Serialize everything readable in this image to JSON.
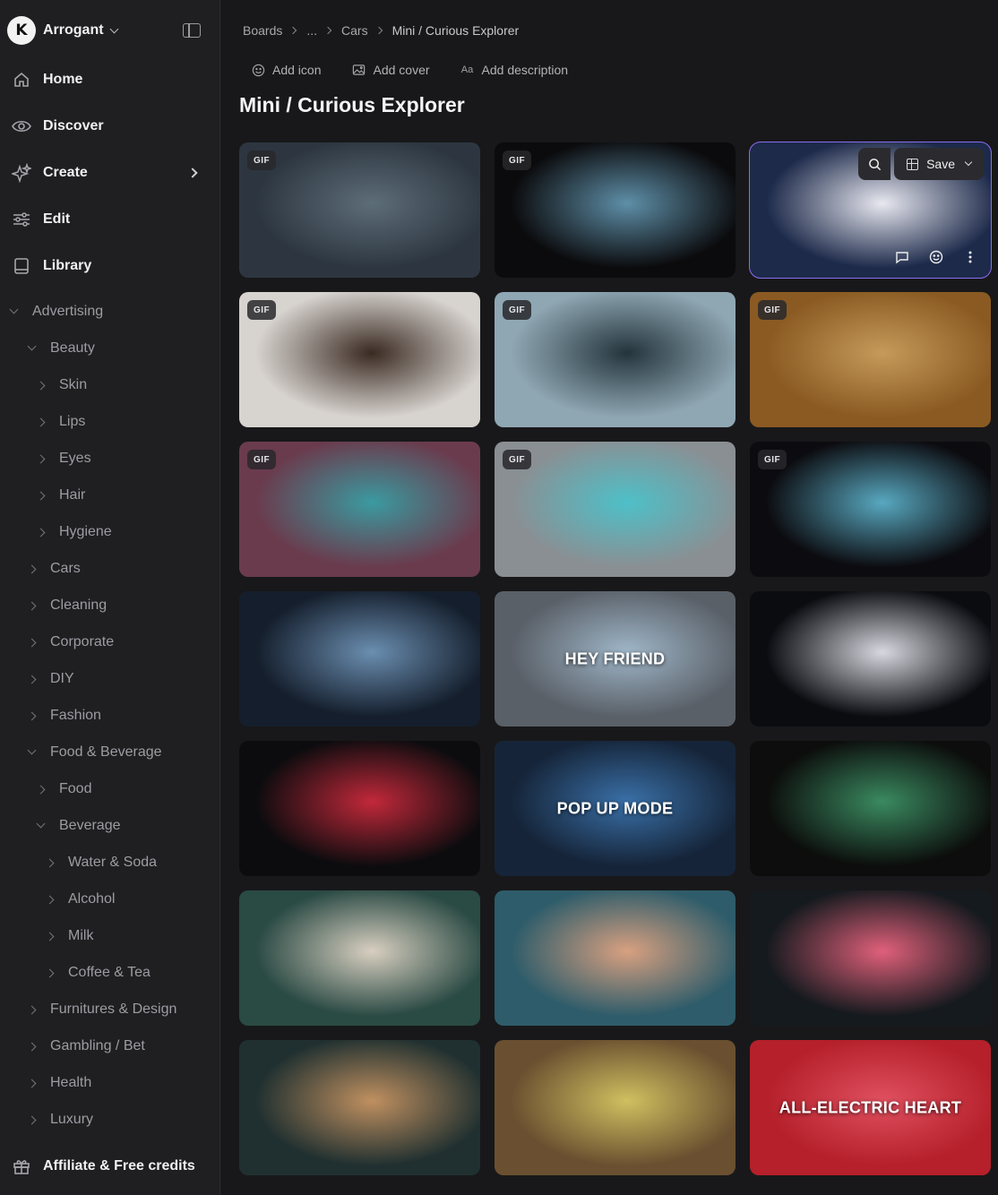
{
  "workspace": {
    "name": "Arrogant",
    "logo_letter": "K"
  },
  "nav": [
    {
      "label": "Home",
      "icon": "home-icon"
    },
    {
      "label": "Discover",
      "icon": "eye-icon"
    },
    {
      "label": "Create",
      "icon": "sparkle-icon"
    },
    {
      "label": "Edit",
      "icon": "sliders-icon"
    },
    {
      "label": "Library",
      "icon": "book-icon"
    }
  ],
  "tree": [
    {
      "label": "Advertising",
      "depth": 0,
      "expanded": true
    },
    {
      "label": "Beauty",
      "depth": 1,
      "expanded": true
    },
    {
      "label": "Skin",
      "depth": 2,
      "expanded": false
    },
    {
      "label": "Lips",
      "depth": 2,
      "expanded": false
    },
    {
      "label": "Eyes",
      "depth": 2,
      "expanded": false
    },
    {
      "label": "Hair",
      "depth": 2,
      "expanded": false
    },
    {
      "label": "Hygiene",
      "depth": 2,
      "expanded": false
    },
    {
      "label": "Cars",
      "depth": 1,
      "expanded": false
    },
    {
      "label": "Cleaning",
      "depth": 1,
      "expanded": false
    },
    {
      "label": "Corporate",
      "depth": 1,
      "expanded": false
    },
    {
      "label": "DIY",
      "depth": 1,
      "expanded": false
    },
    {
      "label": "Fashion",
      "depth": 1,
      "expanded": false
    },
    {
      "label": "Food & Beverage",
      "depth": 1,
      "expanded": true
    },
    {
      "label": "Food",
      "depth": 2,
      "expanded": false
    },
    {
      "label": "Beverage",
      "depth": 2,
      "expanded": true
    },
    {
      "label": "Water & Soda",
      "depth": 3,
      "expanded": false
    },
    {
      "label": "Alcohol",
      "depth": 3,
      "expanded": false
    },
    {
      "label": "Milk",
      "depth": 3,
      "expanded": false
    },
    {
      "label": "Coffee & Tea",
      "depth": 3,
      "expanded": false
    },
    {
      "label": "Furnitures & Design",
      "depth": 1,
      "expanded": false
    },
    {
      "label": "Gambling / Bet",
      "depth": 1,
      "expanded": false
    },
    {
      "label": "Health",
      "depth": 1,
      "expanded": false
    },
    {
      "label": "Luxury",
      "depth": 1,
      "expanded": false
    }
  ],
  "affiliate": {
    "label": "Affiliate & Free credits",
    "icon": "gift-icon"
  },
  "breadcrumb": [
    "Boards",
    "...",
    "Cars",
    "Mini / Curious Explorer"
  ],
  "actions": [
    {
      "label": "Add icon",
      "icon": "smiley-icon"
    },
    {
      "label": "Add cover",
      "icon": "image-icon"
    },
    {
      "label": "Add description",
      "icon": "text-icon"
    }
  ],
  "page": {
    "title": "Mini / Curious Explorer"
  },
  "tile_actions": {
    "save_label": "Save"
  },
  "tiles": [
    {
      "badge": "GIF",
      "text": "",
      "bg": "#2d3640",
      "accent": "#5d6d78"
    },
    {
      "badge": "GIF",
      "text": "",
      "bg": "#0b0b0d",
      "accent": "#5e8fa8"
    },
    {
      "badge": "",
      "text": "",
      "bg": "#1d2a4a",
      "accent": "#e8e8f0",
      "selected": true
    },
    {
      "badge": "GIF",
      "text": "",
      "bg": "#d7d3cf",
      "accent": "#3a2a22"
    },
    {
      "badge": "GIF",
      "text": "",
      "bg": "#8fa7b3",
      "accent": "#24343c"
    },
    {
      "badge": "GIF",
      "text": "",
      "bg": "#8a5a22",
      "accent": "#c59a5a"
    },
    {
      "badge": "GIF",
      "text": "",
      "bg": "#6a3b4d",
      "accent": "#3b9aa0"
    },
    {
      "badge": "GIF",
      "text": "",
      "bg": "#8a8f93",
      "accent": "#4ec0c8"
    },
    {
      "badge": "GIF",
      "text": "",
      "bg": "#0c0c10",
      "accent": "#58a8c0"
    },
    {
      "badge": "",
      "text": "",
      "bg": "#141e2c",
      "accent": "#6b8eb0"
    },
    {
      "badge": "",
      "text": "HEY FRIEND",
      "bg": "#5a6068",
      "accent": "#9fb6c8"
    },
    {
      "badge": "",
      "text": "",
      "bg": "#0a0c10",
      "accent": "#d8d8e0"
    },
    {
      "badge": "",
      "text": "",
      "bg": "#0c0c0e",
      "accent": "#c2283a"
    },
    {
      "badge": "",
      "text": "POP UP MODE",
      "bg": "#152438",
      "accent": "#3a70a8"
    },
    {
      "badge": "",
      "text": "",
      "bg": "#0c0d0c",
      "accent": "#3a8a60"
    },
    {
      "badge": "",
      "text": "",
      "bg": "#2a4a44",
      "accent": "#d8cfc0"
    },
    {
      "badge": "",
      "text": "",
      "bg": "#2e5c6a",
      "accent": "#d8a080"
    },
    {
      "badge": "",
      "text": "",
      "bg": "#151a1e",
      "accent": "#e0607a"
    },
    {
      "badge": "",
      "text": "",
      "bg": "#203030",
      "accent": "#c09060"
    },
    {
      "badge": "",
      "text": "",
      "bg": "#6a5030",
      "accent": "#d0c060"
    },
    {
      "badge": "",
      "text": "ALL-ELECTRIC HEART",
      "bg": "#b5202a",
      "accent": "#e05060"
    }
  ]
}
